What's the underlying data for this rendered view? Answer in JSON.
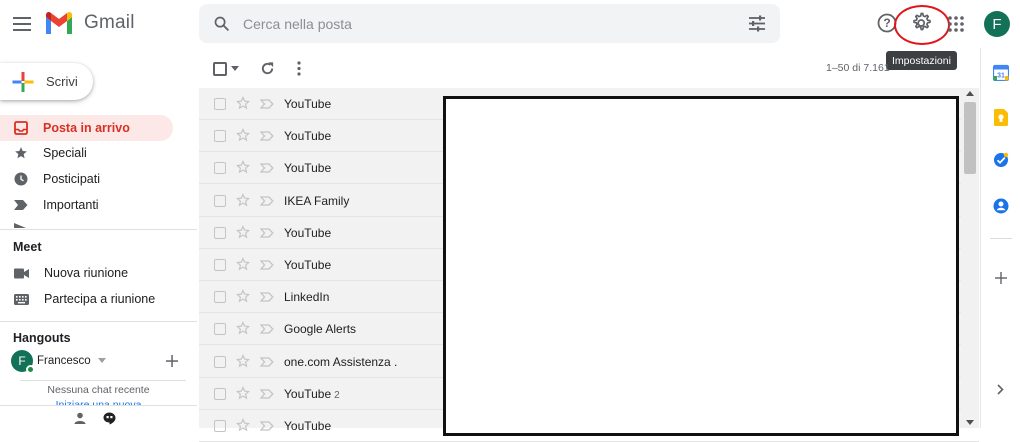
{
  "app": {
    "logo_text": "Gmail"
  },
  "header": {
    "search_placeholder": "Cerca nella posta",
    "avatar_letter": "F",
    "tooltip": "Impostazioni"
  },
  "sidebar": {
    "compose_label": "Scrivi",
    "nav": [
      {
        "label": "Posta in arrivo",
        "icon": "inbox-icon",
        "active": true
      },
      {
        "label": "Speciali",
        "icon": "star-icon"
      },
      {
        "label": "Posticipati",
        "icon": "clock-icon"
      },
      {
        "label": "Importanti",
        "icon": "important-icon"
      }
    ],
    "meet": {
      "title": "Meet",
      "items": [
        {
          "label": "Nuova riunione",
          "icon": "video-icon"
        },
        {
          "label": "Partecipa a riunione",
          "icon": "keyboard-icon"
        }
      ]
    },
    "hangouts": {
      "title": "Hangouts",
      "user_name": "Francesco",
      "user_letter": "F",
      "no_chat": "Nessuna chat recente",
      "start_chat": "Iniziare una nuova"
    }
  },
  "toolbar": {
    "pagination": "1–50 di 7.161"
  },
  "mail_rows": [
    {
      "sender": "YouTube",
      "count": ""
    },
    {
      "sender": "YouTube",
      "count": ""
    },
    {
      "sender": "YouTube",
      "count": ""
    },
    {
      "sender": "IKEA Family",
      "count": ""
    },
    {
      "sender": "YouTube",
      "count": ""
    },
    {
      "sender": "YouTube",
      "count": ""
    },
    {
      "sender": "LinkedIn",
      "count": ""
    },
    {
      "sender": "Google Alerts",
      "count": ""
    },
    {
      "sender": "one.com Assistenza .",
      "count": ""
    },
    {
      "sender": "YouTube",
      "count": "2"
    },
    {
      "sender": "YouTube",
      "count": ""
    }
  ],
  "colors": {
    "accent_red": "#d93025",
    "active_bg": "#fce8e6",
    "avatar_green": "#137157",
    "highlight_ring": "#e0161c"
  }
}
